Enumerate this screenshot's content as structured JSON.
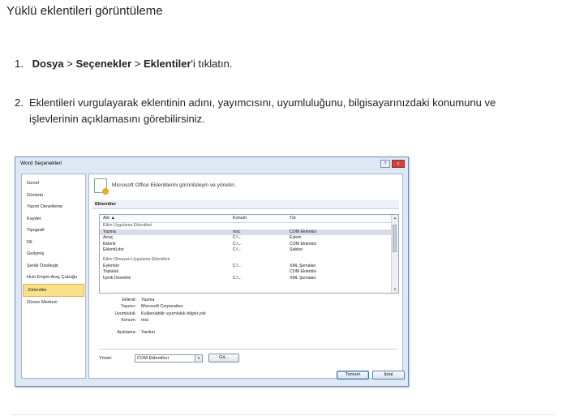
{
  "heading": "Yüklü eklentileri görüntüleme",
  "steps": [
    {
      "num": "1.",
      "parts": [
        "Dosya",
        "Seçenekler",
        "Eklentiler"
      ],
      "sep": ">",
      "suffix": "'i tıklatın."
    },
    {
      "num": "2.",
      "text": "Eklentileri vurgulayarak eklentinin adını, yayımcısını, uyumluluğunu, bilgisayarınızdaki konumunu ve işlevlerinin açıklamasını görebilirsiniz."
    }
  ],
  "dialog": {
    "title": "Word Seçenekleri",
    "title_buttons": [
      "?",
      "x"
    ],
    "nav": [
      "Genel",
      "Görüntü",
      "Yazım Denetleme",
      "Kaydet",
      "Tipografi",
      "Dil",
      "Gelişmiş",
      "Şeridi Özelleştir",
      "Hızlı Erişim Araç Çubuğu",
      "Eklentiler",
      "Güven Merkezi"
    ],
    "nav_selected": "Eklentiler",
    "header_text": "Microsoft Office Eklentilerini görüntüleyin ve yönetin.",
    "section": "Eklentiler",
    "columns": [
      "Adı ▲",
      "Konum",
      "Tür"
    ],
    "rows": [
      {
        "type": "group",
        "name": "Etkin Uygulama Eklentileri"
      },
      {
        "type": "row",
        "name": "Yazma",
        "loc": "msc",
        "kind": "COM Eklentisi",
        "selected": true
      },
      {
        "type": "row",
        "name": "Arraç",
        "loc": "C:\\...",
        "kind": "Eylem"
      },
      {
        "type": "row",
        "name": "Eklenti",
        "loc": "C:\\...",
        "kind": "COM Eklentisi"
      },
      {
        "type": "row",
        "name": "EklentiLdot",
        "loc": "C:\\...",
        "kind": "Şablon"
      },
      {
        "type": "gap"
      },
      {
        "type": "group",
        "name": "Etkin Olmayan Uygulama Eklentileri"
      },
      {
        "type": "row",
        "name": "Eylemler",
        "loc": "C:\\...",
        "kind": "XML Şemaları"
      },
      {
        "type": "row",
        "name": "Topluluk",
        "loc": "",
        "kind": "COM Eklentisi"
      },
      {
        "type": "row",
        "name": "İçerik Denetimi",
        "loc": "C:\\...",
        "kind": "XML Şemaları"
      }
    ],
    "details": [
      {
        "k": "Eklenti:",
        "v": "Yazma"
      },
      {
        "k": "Yayıncı:",
        "v": "Microsoft Corporation"
      },
      {
        "k": "Uyumluluk:",
        "v": "Kullanılabilir uyumluluk bilgisi yok"
      },
      {
        "k": "Konum:",
        "v": "msc"
      },
      {
        "k": "Açıklama:",
        "v": "Yardım",
        "spaced": true
      }
    ],
    "manage_label": "Yönet:",
    "manage_value": "COM Eklentileri",
    "go_label": "Git...",
    "ok_label": "Tamam",
    "cancel_label": "İptal"
  }
}
